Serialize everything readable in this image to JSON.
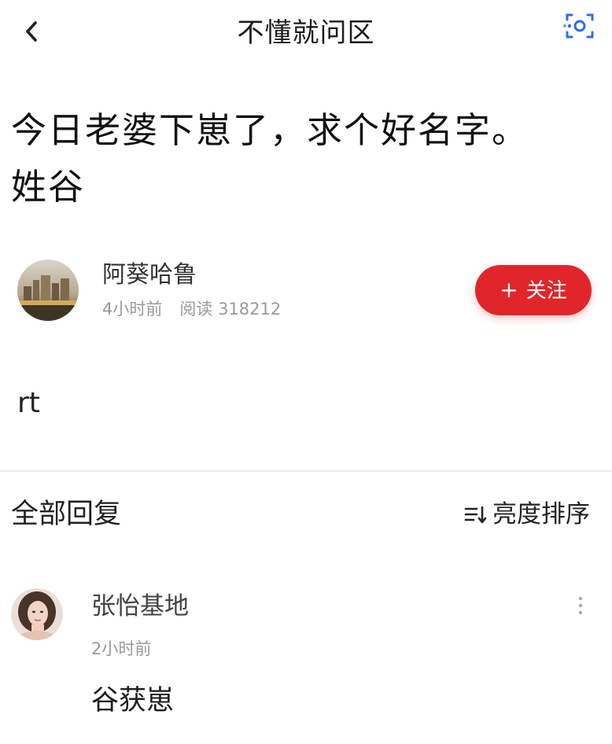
{
  "header": {
    "back_icon": "chevron-left-icon",
    "title": "不懂就问区",
    "scan_icon": "scan-icon"
  },
  "question": {
    "title": "今日老婆下崽了，求个好名字。姓谷",
    "body": "rt"
  },
  "author": {
    "name": "阿葵哈鲁",
    "time": "4小时前",
    "reads_label": "阅读",
    "reads_count": "318212",
    "avatar_icon": "city-avatar-icon"
  },
  "follow": {
    "label": "关注",
    "plus": "+",
    "color": "#e0262b"
  },
  "replies": {
    "title": "全部回复",
    "sort_label": "亮度排序",
    "sort_icon": "sort-icon",
    "items": [
      {
        "name": "张怡基地",
        "time": "2小时前",
        "content": "谷获崽",
        "avatar_icon": "person-avatar-icon",
        "more_icon": "more-vertical-icon"
      }
    ]
  }
}
